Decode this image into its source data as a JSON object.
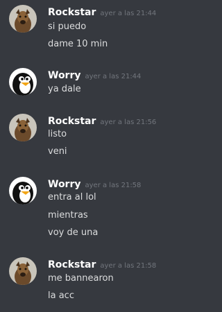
{
  "messages": [
    {
      "author": "Rockstar",
      "avatar_icon": "dog-icon",
      "timestamp": "ayer a las 21:44",
      "lines": [
        "si puedo",
        "dame 10 min"
      ]
    },
    {
      "author": "Worry",
      "avatar_icon": "penguin-icon",
      "timestamp": "ayer a las 21:44",
      "lines": [
        "ya dale"
      ]
    },
    {
      "author": "Rockstar",
      "avatar_icon": "dog-icon",
      "timestamp": "ayer a las 21:56",
      "lines": [
        "listo",
        "veni"
      ]
    },
    {
      "author": "Worry",
      "avatar_icon": "penguin-icon",
      "timestamp": "ayer a las 21:58",
      "lines": [
        "entra al lol",
        "mientras",
        "voy de una"
      ]
    },
    {
      "author": "Rockstar",
      "avatar_icon": "dog-icon",
      "timestamp": "ayer a las 21:58",
      "lines": [
        "me bannearon",
        "la acc"
      ]
    }
  ],
  "colors": {
    "background": "#36393f",
    "author": "#ffffff",
    "timestamp": "#72767d",
    "message_text": "#dcddde"
  }
}
